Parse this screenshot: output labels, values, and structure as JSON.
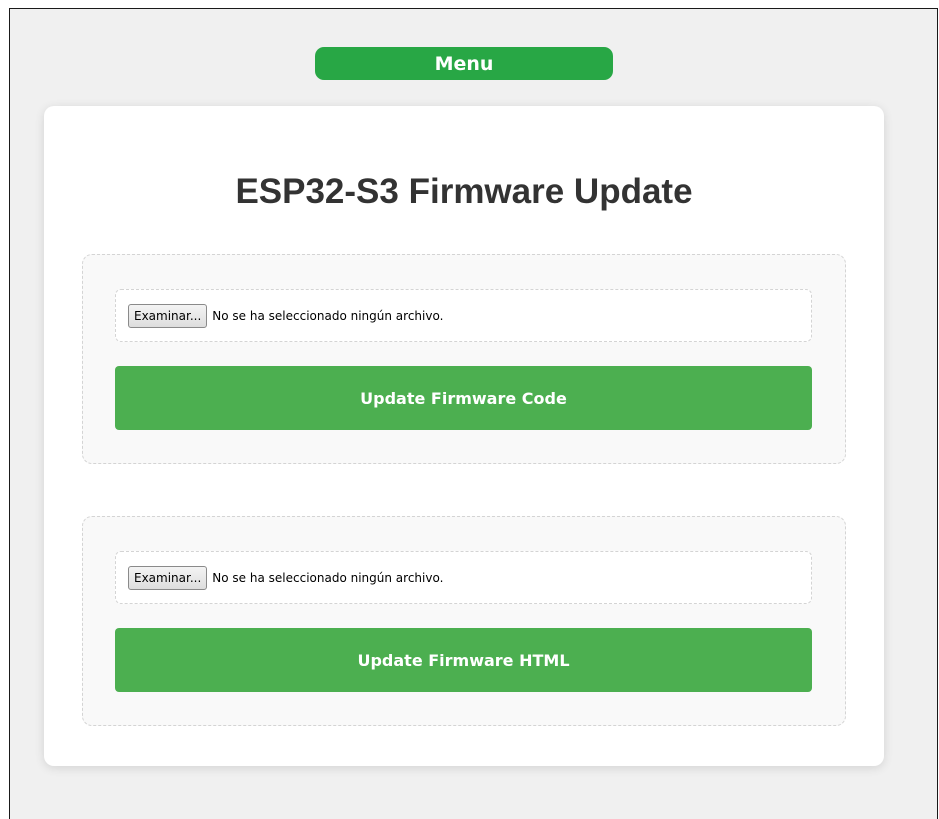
{
  "menu": {
    "label": "Menu"
  },
  "page": {
    "title": "ESP32-S3 Firmware Update"
  },
  "sections": [
    {
      "file_input": {
        "button_label": "Examinar...",
        "status": "No se ha seleccionado ningún archivo."
      },
      "submit_label": "Update Firmware Code"
    },
    {
      "file_input": {
        "button_label": "Examinar...",
        "status": "No se ha seleccionado ningún archivo."
      },
      "submit_label": "Update Firmware HTML"
    }
  ],
  "colors": {
    "menu_green": "#28a745",
    "button_green": "#4caf50",
    "page_background": "#f0f0f0",
    "title_text": "#333333"
  }
}
